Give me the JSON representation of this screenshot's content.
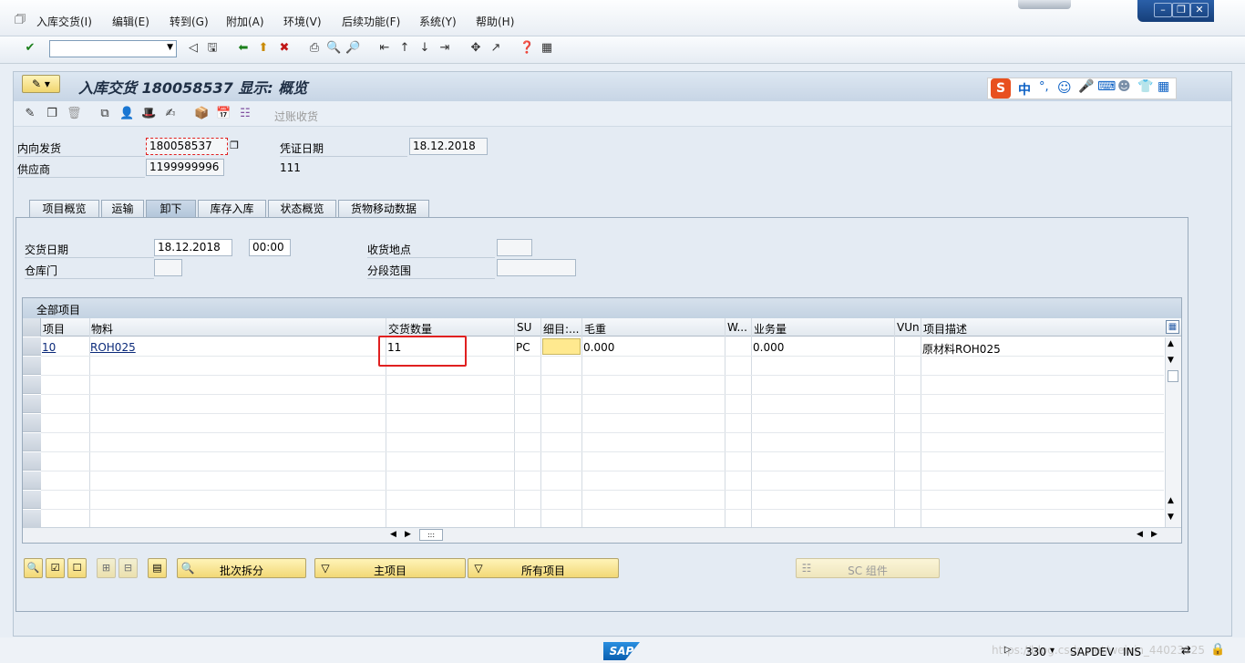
{
  "menu": {
    "items": [
      "入库交货(I)",
      "编辑(E)",
      "转到(G)",
      "附加(A)",
      "环境(V)",
      "后续功能(F)",
      "系统(Y)",
      "帮助(H)"
    ]
  },
  "toolbar": {
    "command_value": ""
  },
  "header": {
    "title": "入库交货 180058537 显示: 概览"
  },
  "ime": {
    "label": "中"
  },
  "app_toolbar": {
    "post_gr_label": "过账收货"
  },
  "form": {
    "inbound_delivery_label": "内向发货",
    "inbound_delivery_value": "180058537",
    "vendor_label": "供应商",
    "vendor_value": "1199999996",
    "doc_date_label": "凭证日期",
    "doc_date_value": "18.12.2018",
    "vendor_name": "111"
  },
  "tabs": [
    {
      "label": "项目概览",
      "active": false
    },
    {
      "label": "运输",
      "active": false
    },
    {
      "label": "卸下",
      "active": true
    },
    {
      "label": "库存入库",
      "active": false
    },
    {
      "label": "状态概览",
      "active": false
    },
    {
      "label": "货物移动数据",
      "active": false
    }
  ],
  "unload": {
    "delivery_date_label": "交货日期",
    "delivery_date_value": "18.12.2018",
    "delivery_time_value": "00:00",
    "door_label": "仓库门",
    "door_value": "",
    "unloading_point_label": "收货地点",
    "unloading_point_value": "",
    "staging_area_label": "分段范围",
    "staging_area_value": ""
  },
  "grid": {
    "title": "全部项目",
    "columns": [
      "项目",
      "物料",
      "交货数量",
      "SU",
      "细目:...",
      "毛重",
      "W...",
      "业务量",
      "VUn",
      "项目描述"
    ],
    "rows": [
      {
        "item": "10",
        "material": "ROH025",
        "qty": "11",
        "su": "PC",
        "detail": "",
        "gross_weight": "0.000",
        "w": "",
        "volume": "0.000",
        "vun": "",
        "desc": "原材料ROH025"
      }
    ]
  },
  "buttons": {
    "batch_split": "批次拆分",
    "main_item": "主项目",
    "all_items": "所有项目",
    "sc_component": "SC 组件"
  },
  "status": {
    "session": "330",
    "system": "SAPDEV",
    "mode": "INS",
    "watermark": "https://blog.csdn.net/weixin_44023825"
  },
  "colors": {
    "highlight_box": "#e02020",
    "button_yellow": "#f7e08c",
    "sap_blue": "#0a6ed1"
  }
}
